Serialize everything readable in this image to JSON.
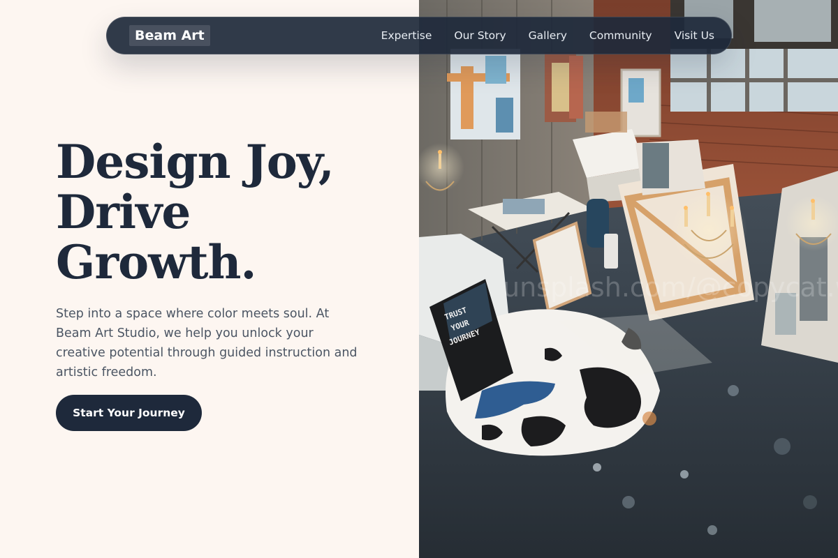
{
  "nav": {
    "logo": "Beam Art",
    "links": [
      "Expertise",
      "Our Story",
      "Gallery",
      "Community",
      "Visit Us"
    ]
  },
  "hero": {
    "title_lines": [
      "Design Joy,",
      "Drive",
      "Growth."
    ],
    "description": "Step into a space where color meets soul. At Beam Art Studio, we help you unlock your creative potential through guided instruction and artistic freedom.",
    "cta_label": "Start Your Journey"
  },
  "photo": {
    "sign_text": [
      "TRUST",
      "YOUR",
      "JOURNEY"
    ],
    "watermark": "unsplash.com/@copycat.works"
  },
  "colors": {
    "background": "#fdf6f1",
    "navy": "#1e293b",
    "text_muted": "#4b5563"
  }
}
